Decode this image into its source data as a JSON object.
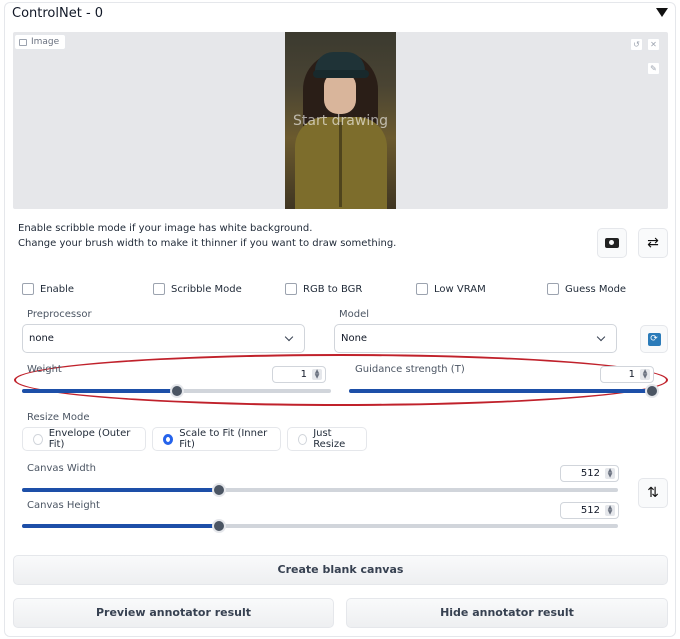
{
  "header": {
    "title": "ControlNet - 0",
    "collapse_icon": "triangle-down-icon"
  },
  "image_panel": {
    "label": "Image",
    "overlay_text": "Start drawing",
    "undo_icon": "undo-icon",
    "close_icon": "close-icon",
    "brush_icon": "brush-icon"
  },
  "hints": {
    "line1": "Enable scribble mode if your image has white background.",
    "line2": "Change your brush width to make it thinner if you want to draw something."
  },
  "icon_buttons": {
    "camera": "camera-icon",
    "swap": "⇄",
    "refresh": "refresh-icon",
    "swap_dims": "⇅"
  },
  "checkboxes": [
    {
      "label": "Enable",
      "checked": false
    },
    {
      "label": "Scribble Mode",
      "checked": false
    },
    {
      "label": "RGB to BGR",
      "checked": false
    },
    {
      "label": "Low VRAM",
      "checked": false
    },
    {
      "label": "Guess Mode",
      "checked": false
    }
  ],
  "preprocessor": {
    "label": "Preprocessor",
    "value": "none"
  },
  "model": {
    "label": "Model",
    "value": "None"
  },
  "weight": {
    "label": "Weight",
    "value": "1",
    "fraction": 0.5
  },
  "guidance": {
    "label": "Guidance strength (T)",
    "value": "1",
    "fraction": 1.0
  },
  "resize_mode": {
    "label": "Resize Mode",
    "options": [
      "Envelope (Outer Fit)",
      "Scale to Fit (Inner Fit)",
      "Just Resize"
    ],
    "selected": 1
  },
  "canvas_width": {
    "label": "Canvas Width",
    "value": "512",
    "fraction": 0.33
  },
  "canvas_height": {
    "label": "Canvas Height",
    "value": "512",
    "fraction": 0.33
  },
  "buttons": {
    "create_canvas": "Create blank canvas",
    "preview": "Preview annotator result",
    "hide": "Hide annotator result"
  },
  "colors": {
    "accent": "#1d4fa8",
    "highlight": "#c0212b",
    "radio_selected": "#2563eb"
  }
}
